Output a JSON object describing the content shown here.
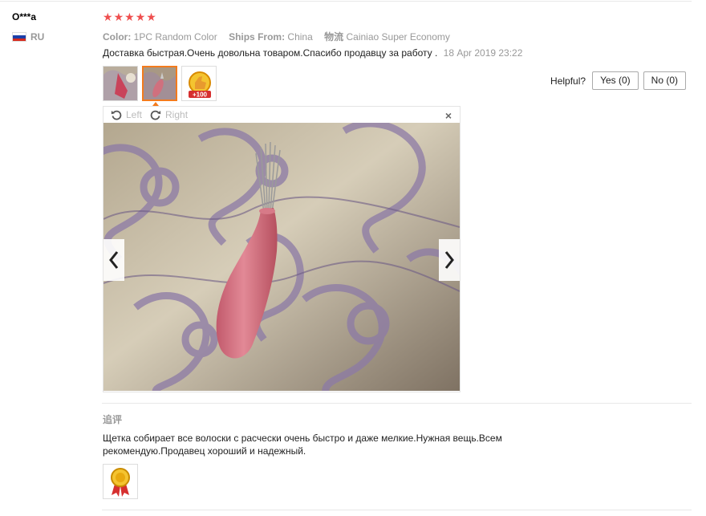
{
  "review": {
    "user_name": "O***a",
    "country_code": "RU",
    "rating": 5,
    "props": [
      {
        "label": "Color:",
        "value": "1PC Random Color"
      },
      {
        "label": "Ships From:",
        "value": "China"
      },
      {
        "label": "物流",
        "value": "Cainiao Super Economy"
      }
    ],
    "text": "Доставка быстрая.Очень довольна товаром.Спасибо продавцу за работу .",
    "date": "18 Apr 2019 23:22"
  },
  "helpful": {
    "label": "Helpful?",
    "yes_label": "Yes (0)",
    "no_label": "No (0)"
  },
  "viewer": {
    "rotate_left_label": "Left",
    "rotate_right_label": "Right",
    "close_icon": "×"
  },
  "followup": {
    "label": "追评",
    "text": "Щетка собирает все волоски с расчески очень быстро и даже мелкие.Нужная вещь.Всем рекомендую.Продавец хороший и надежный."
  },
  "colors": {
    "star": "#ef4f4f",
    "active_thumb": "#f37b1d"
  }
}
